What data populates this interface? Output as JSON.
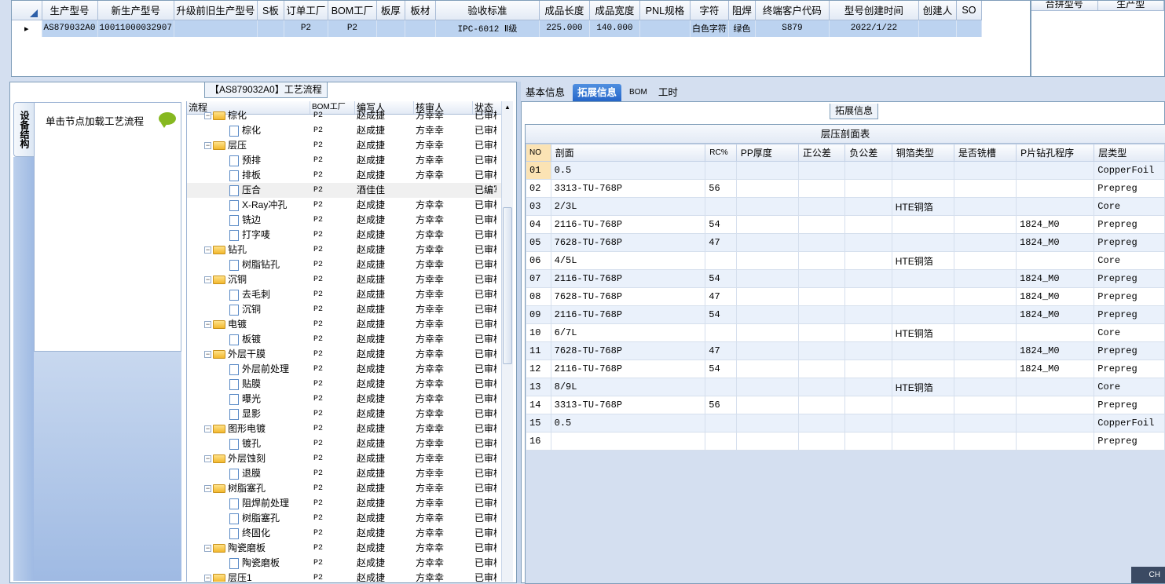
{
  "top_grid": {
    "columns": [
      "生产型号",
      "新生产型号",
      "升级前旧生产型号",
      "S板",
      "订单工厂",
      "BOM工厂",
      "板厚",
      "板材",
      "验收标准",
      "成品长度",
      "成品宽度",
      "PNL规格",
      "字符",
      "阻焊",
      "终端客户代码",
      "型号创建时间",
      "创建人",
      "SO"
    ],
    "rows": [
      [
        "AS879032A0",
        "10011000032907",
        "",
        "",
        "P2",
        "P2",
        "",
        "",
        "IPC-6012 Ⅱ级",
        "225.000",
        "140.000",
        "",
        "白色字符",
        "绿色",
        "S879",
        "2022/1/22",
        "",
        ""
      ]
    ]
  },
  "right_panel": {
    "columns": [
      "合拼型号",
      "生产型"
    ]
  },
  "left_pane": {
    "caption": "【AS879032A0】工艺流程",
    "vertical_tab": "设备结构",
    "node_hint": "单击节点加载工艺流程",
    "tree_header": [
      "流程",
      "BOM工厂",
      "编写人",
      "核审人",
      "状态"
    ],
    "tree_rows": [
      {
        "type": "folder",
        "label": "棕化",
        "bom": "P2",
        "writer": "赵成捷",
        "reviewer": "方幸幸",
        "status": "已审核"
      },
      {
        "type": "doc",
        "label": "棕化",
        "bom": "P2",
        "writer": "赵成捷",
        "reviewer": "方幸幸",
        "status": "已审核"
      },
      {
        "type": "folder",
        "label": "层压",
        "bom": "P2",
        "writer": "赵成捷",
        "reviewer": "方幸幸",
        "status": "已审核"
      },
      {
        "type": "doc",
        "label": "预排",
        "bom": "P2",
        "writer": "赵成捷",
        "reviewer": "方幸幸",
        "status": "已审核"
      },
      {
        "type": "doc",
        "label": "排板",
        "bom": "P2",
        "writer": "赵成捷",
        "reviewer": "方幸幸",
        "status": "已审核"
      },
      {
        "type": "doc",
        "label": "压合",
        "bom": "P2",
        "writer": "酒佳佳",
        "reviewer": "",
        "status": "已编写",
        "selected": true
      },
      {
        "type": "doc",
        "label": "X-Ray冲孔",
        "bom": "P2",
        "writer": "赵成捷",
        "reviewer": "方幸幸",
        "status": "已审核"
      },
      {
        "type": "doc",
        "label": "铣边",
        "bom": "P2",
        "writer": "赵成捷",
        "reviewer": "方幸幸",
        "status": "已审核"
      },
      {
        "type": "doc",
        "label": "打字唛",
        "bom": "P2",
        "writer": "赵成捷",
        "reviewer": "方幸幸",
        "status": "已审核"
      },
      {
        "type": "folder",
        "label": "钻孔",
        "bom": "P2",
        "writer": "赵成捷",
        "reviewer": "方幸幸",
        "status": "已审核"
      },
      {
        "type": "doc",
        "label": "树脂钻孔",
        "bom": "P2",
        "writer": "赵成捷",
        "reviewer": "方幸幸",
        "status": "已审核"
      },
      {
        "type": "folder",
        "label": "沉铜",
        "bom": "P2",
        "writer": "赵成捷",
        "reviewer": "方幸幸",
        "status": "已审核"
      },
      {
        "type": "doc",
        "label": "去毛刺",
        "bom": "P2",
        "writer": "赵成捷",
        "reviewer": "方幸幸",
        "status": "已审核"
      },
      {
        "type": "doc",
        "label": "沉铜",
        "bom": "P2",
        "writer": "赵成捷",
        "reviewer": "方幸幸",
        "status": "已审核"
      },
      {
        "type": "folder",
        "label": "电镀",
        "bom": "P2",
        "writer": "赵成捷",
        "reviewer": "方幸幸",
        "status": "已审核"
      },
      {
        "type": "doc",
        "label": "板镀",
        "bom": "P2",
        "writer": "赵成捷",
        "reviewer": "方幸幸",
        "status": "已审核"
      },
      {
        "type": "folder",
        "label": "外层干膜",
        "bom": "P2",
        "writer": "赵成捷",
        "reviewer": "方幸幸",
        "status": "已审核"
      },
      {
        "type": "doc",
        "label": "外层前处理",
        "bom": "P2",
        "writer": "赵成捷",
        "reviewer": "方幸幸",
        "status": "已审核"
      },
      {
        "type": "doc",
        "label": "贴膜",
        "bom": "P2",
        "writer": "赵成捷",
        "reviewer": "方幸幸",
        "status": "已审核"
      },
      {
        "type": "doc",
        "label": "曝光",
        "bom": "P2",
        "writer": "赵成捷",
        "reviewer": "方幸幸",
        "status": "已审核"
      },
      {
        "type": "doc",
        "label": "显影",
        "bom": "P2",
        "writer": "赵成捷",
        "reviewer": "方幸幸",
        "status": "已审核"
      },
      {
        "type": "folder",
        "label": "图形电镀",
        "bom": "P2",
        "writer": "赵成捷",
        "reviewer": "方幸幸",
        "status": "已审核"
      },
      {
        "type": "doc",
        "label": "镀孔",
        "bom": "P2",
        "writer": "赵成捷",
        "reviewer": "方幸幸",
        "status": "已审核"
      },
      {
        "type": "folder",
        "label": "外层蚀刻",
        "bom": "P2",
        "writer": "赵成捷",
        "reviewer": "方幸幸",
        "status": "已审核"
      },
      {
        "type": "doc",
        "label": "退膜",
        "bom": "P2",
        "writer": "赵成捷",
        "reviewer": "方幸幸",
        "status": "已审核"
      },
      {
        "type": "folder",
        "label": "树脂塞孔",
        "bom": "P2",
        "writer": "赵成捷",
        "reviewer": "方幸幸",
        "status": "已审核"
      },
      {
        "type": "doc",
        "label": "阻焊前处理",
        "bom": "P2",
        "writer": "赵成捷",
        "reviewer": "方幸幸",
        "status": "已审核"
      },
      {
        "type": "doc",
        "label": "树脂塞孔",
        "bom": "P2",
        "writer": "赵成捷",
        "reviewer": "方幸幸",
        "status": "已审核"
      },
      {
        "type": "doc",
        "label": "终固化",
        "bom": "P2",
        "writer": "赵成捷",
        "reviewer": "方幸幸",
        "status": "已审核"
      },
      {
        "type": "folder",
        "label": "陶瓷磨板",
        "bom": "P2",
        "writer": "赵成捷",
        "reviewer": "方幸幸",
        "status": "已审核"
      },
      {
        "type": "doc",
        "label": "陶瓷磨板",
        "bom": "P2",
        "writer": "赵成捷",
        "reviewer": "方幸幸",
        "status": "已审核"
      },
      {
        "type": "folder",
        "label": "层压1",
        "bom": "P2",
        "writer": "赵成捷",
        "reviewer": "方幸幸",
        "status": "已审核"
      }
    ]
  },
  "right_pane": {
    "tabs": [
      "基本信息",
      "拓展信息",
      "BOM",
      "工时"
    ],
    "active_tab": "拓展信息",
    "caption": "拓展信息",
    "band_title": "层压剖面表",
    "columns": [
      "NO",
      "剖面",
      "RC%",
      "PP厚度",
      "正公差",
      "负公差",
      "铜箔类型",
      "是否铣槽",
      "P片钻孔程序",
      "层类型"
    ],
    "rows": [
      [
        "01",
        "0.5",
        "",
        "",
        "",
        "",
        "",
        "",
        "",
        "CopperFoil"
      ],
      [
        "02",
        "3313-TU-768P",
        "56",
        "",
        "",
        "",
        "",
        "",
        "",
        "Prepreg"
      ],
      [
        "03",
        "2/3L",
        "",
        "",
        "",
        "",
        "HTE铜箔",
        "",
        "",
        "Core"
      ],
      [
        "04",
        "2116-TU-768P",
        "54",
        "",
        "",
        "",
        "",
        "",
        "1824_M0",
        "Prepreg"
      ],
      [
        "05",
        "7628-TU-768P",
        "47",
        "",
        "",
        "",
        "",
        "",
        "1824_M0",
        "Prepreg"
      ],
      [
        "06",
        "4/5L",
        "",
        "",
        "",
        "",
        "HTE铜箔",
        "",
        "",
        "Core"
      ],
      [
        "07",
        "2116-TU-768P",
        "54",
        "",
        "",
        "",
        "",
        "",
        "1824_M0",
        "Prepreg"
      ],
      [
        "08",
        "7628-TU-768P",
        "47",
        "",
        "",
        "",
        "",
        "",
        "1824_M0",
        "Prepreg"
      ],
      [
        "09",
        "2116-TU-768P",
        "54",
        "",
        "",
        "",
        "",
        "",
        "1824_M0",
        "Prepreg"
      ],
      [
        "10",
        "6/7L",
        "",
        "",
        "",
        "",
        "HTE铜箔",
        "",
        "",
        "Core"
      ],
      [
        "11",
        "7628-TU-768P",
        "47",
        "",
        "",
        "",
        "",
        "",
        "1824_M0",
        "Prepreg"
      ],
      [
        "12",
        "2116-TU-768P",
        "54",
        "",
        "",
        "",
        "",
        "",
        "1824_M0",
        "Prepreg"
      ],
      [
        "13",
        "8/9L",
        "",
        "",
        "",
        "",
        "HTE铜箔",
        "",
        "",
        "Core"
      ],
      [
        "14",
        "3313-TU-768P",
        "56",
        "",
        "",
        "",
        "",
        "",
        "",
        "Prepreg"
      ],
      [
        "15",
        "0.5",
        "",
        "",
        "",
        "",
        "",
        "",
        "",
        "CopperFoil"
      ],
      [
        "16",
        "",
        "",
        "",
        "",
        "",
        "",
        "",
        "",
        "Prepreg"
      ]
    ]
  },
  "status_badge": "CH"
}
